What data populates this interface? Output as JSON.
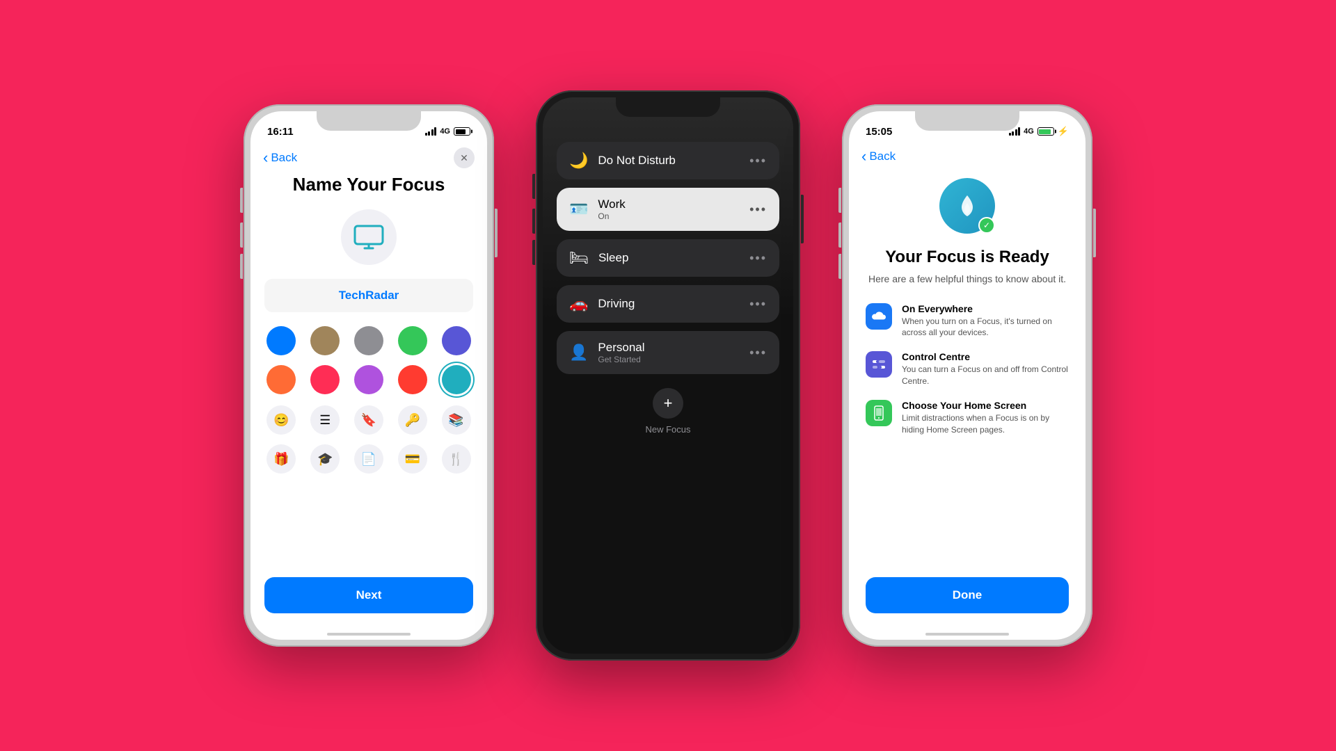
{
  "background": "#F5245A",
  "phone1": {
    "status_time": "16:11",
    "status_signal": "4G",
    "nav_back": "Back",
    "nav_close": "✕",
    "title": "Name Your Focus",
    "input_value": "TechRadar",
    "colors": [
      {
        "hex": "#007AFF",
        "selected": false
      },
      {
        "hex": "#A0855B",
        "selected": false
      },
      {
        "hex": "#8E8E93",
        "selected": false
      },
      {
        "hex": "#34C759",
        "selected": false
      },
      {
        "hex": "#5856D6",
        "selected": false
      },
      {
        "hex": "#FF6B35",
        "selected": false
      },
      {
        "hex": "#FF2D55",
        "selected": false
      },
      {
        "hex": "#AF52DE",
        "selected": false
      },
      {
        "hex": "#FF3B30",
        "selected": false
      },
      {
        "hex": "#20AEBE",
        "selected": true
      }
    ],
    "icons": [
      "😊",
      "☰",
      "🔖",
      "🔑",
      "📚",
      "🎁",
      "🎓",
      "📄",
      "💳",
      "🍴"
    ],
    "next_button": "Next"
  },
  "phone2": {
    "focus_items": [
      {
        "name": "Do Not Disturb",
        "sub": "",
        "icon": "🌙",
        "active": false
      },
      {
        "name": "Work",
        "sub": "On",
        "icon": "🪪",
        "active": true
      },
      {
        "name": "Sleep",
        "sub": "",
        "icon": "🛏",
        "active": false
      },
      {
        "name": "Driving",
        "sub": "",
        "icon": "🚗",
        "active": false
      },
      {
        "name": "Personal",
        "sub": "Get Started",
        "icon": "👤",
        "active": false
      }
    ],
    "add_label": "New Focus"
  },
  "phone3": {
    "status_time": "15:05",
    "status_signal": "4G",
    "nav_back": "Back",
    "title": "Your Focus is Ready",
    "subtitle": "Here are a few helpful things to know about it.",
    "features": [
      {
        "icon": "☁️",
        "color": "blue",
        "title": "On Everywhere",
        "desc": "When you turn on a Focus, it's turned on across all your devices."
      },
      {
        "icon": "⚙️",
        "color": "indigo",
        "title": "Control Centre",
        "desc": "You can turn a Focus on and off from Control Centre."
      },
      {
        "icon": "📱",
        "color": "green",
        "title": "Choose Your Home Screen",
        "desc": "Limit distractions when a Focus is on by hiding Home Screen pages."
      }
    ],
    "done_button": "Done"
  }
}
